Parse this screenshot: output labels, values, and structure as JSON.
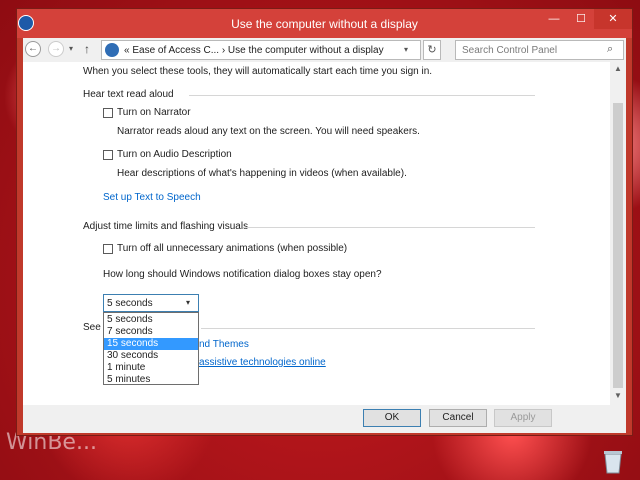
{
  "window": {
    "title": "Use the computer without a display",
    "minimize": "—",
    "maximize": "☐",
    "close": "✕"
  },
  "navbar": {
    "back_icon": "←",
    "forward_icon": "→",
    "recent_icon": "▾",
    "up_icon": "↑",
    "address": "«  Ease of Access C...  ›  Use the computer without a display",
    "address_dropdown_icon": "▾",
    "refresh_icon": "↻",
    "search_placeholder": "Search Control Panel",
    "search_icon": "⌕"
  },
  "content": {
    "intro": "When you select these tools, they will automatically start each time you sign in.",
    "section1": {
      "header": "Hear text read aloud",
      "narrator_label": "Turn on Narrator",
      "narrator_checked": false,
      "narrator_desc": "Narrator reads aloud any text on the screen. You will need speakers.",
      "audio_desc_label": "Turn on Audio Description",
      "audio_desc_checked": false,
      "audio_desc_desc": "Hear descriptions of what's happening in videos (when available).",
      "tts_link": "Set up Text to Speech"
    },
    "section2": {
      "header": "Adjust time limits and flashing visuals",
      "animations_label": "Turn off all unnecessary animations (when possible)",
      "animations_checked": false,
      "notif_question": "How long should Windows notification dialog boxes stay open?",
      "selected": "5 seconds",
      "options": [
        "5 seconds",
        "7 seconds",
        "15 seconds",
        "30 seconds",
        "1 minute",
        "5 minutes"
      ],
      "highlighted_option": "15 seconds"
    },
    "section3": {
      "header_partial": "See a",
      "link1_partial": "nd Themes",
      "link2_partial": "assistive technologies online"
    }
  },
  "scrollbar": {
    "up": "▲",
    "down": "▼"
  },
  "footer": {
    "ok": "OK",
    "cancel": "Cancel",
    "apply": "Apply"
  },
  "desktop": {
    "watermark": "WinBe...",
    "recycle_bin_icon": "recycle-bin"
  },
  "colors": {
    "title_bar": "#d4413a",
    "link": "#0066cc",
    "selection": "#3399ff"
  }
}
